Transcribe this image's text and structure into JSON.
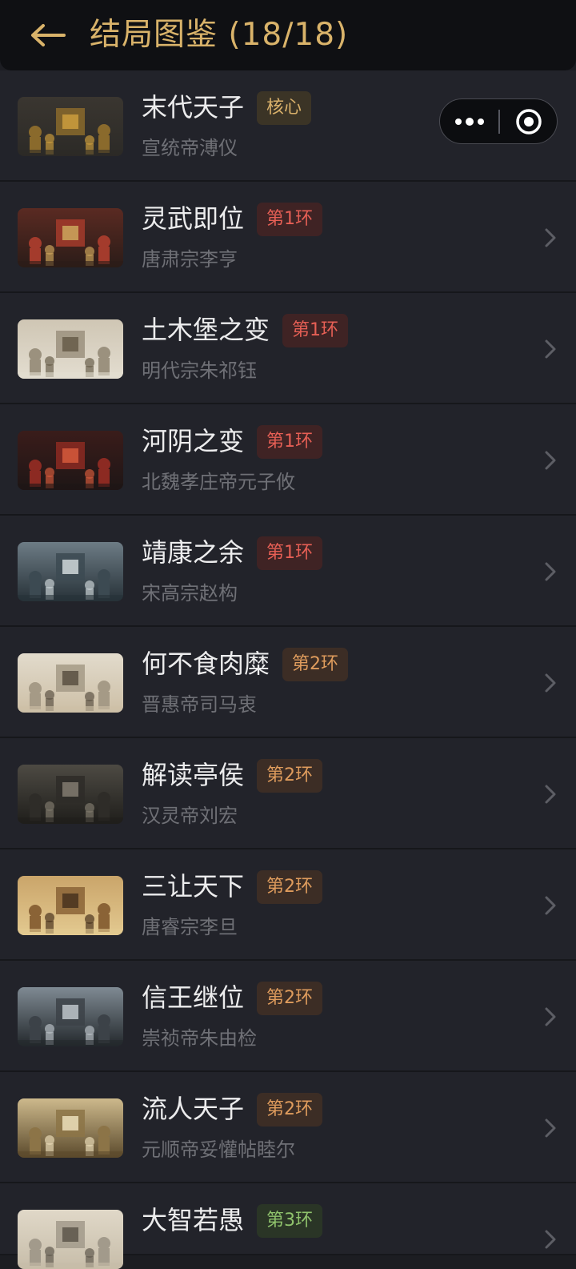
{
  "header": {
    "title": "结局图鉴 (18/18)",
    "back_icon": "arrow-left-icon",
    "accent_color": "#d9b36a"
  },
  "capsule": {
    "more_icon": "more-dots-icon",
    "close_icon": "target-close-icon"
  },
  "endings": [
    {
      "name": "末代天子",
      "tag": "核心",
      "tier": "core",
      "emperor": "宣统帝溥仪"
    },
    {
      "name": "灵武即位",
      "tag": "第1环",
      "tier": "1",
      "emperor": "唐肃宗李亨"
    },
    {
      "name": "土木堡之变",
      "tag": "第1环",
      "tier": "1",
      "emperor": "明代宗朱祁钰"
    },
    {
      "name": "河阴之变",
      "tag": "第1环",
      "tier": "1",
      "emperor": "北魏孝庄帝元子攸"
    },
    {
      "name": "靖康之余",
      "tag": "第1环",
      "tier": "1",
      "emperor": "宋高宗赵构"
    },
    {
      "name": "何不食肉糜",
      "tag": "第2环",
      "tier": "2",
      "emperor": "晋惠帝司马衷"
    },
    {
      "name": "解读亭侯",
      "tag": "第2环",
      "tier": "2",
      "emperor": "汉灵帝刘宏"
    },
    {
      "name": "三让天下",
      "tag": "第2环",
      "tier": "2",
      "emperor": "唐睿宗李旦"
    },
    {
      "name": "信王继位",
      "tag": "第2环",
      "tier": "2",
      "emperor": "崇祯帝朱由检"
    },
    {
      "name": "流人天子",
      "tag": "第2环",
      "tier": "2",
      "emperor": "元顺帝妥懽帖睦尔"
    },
    {
      "name": "大智若愚",
      "tag": "第3环",
      "tier": "3",
      "emperor": ""
    }
  ],
  "tier_colors": {
    "core": "#d8b06a",
    "1": "#e65f55",
    "2": "#df9c5d",
    "3": "#8fc26c"
  }
}
